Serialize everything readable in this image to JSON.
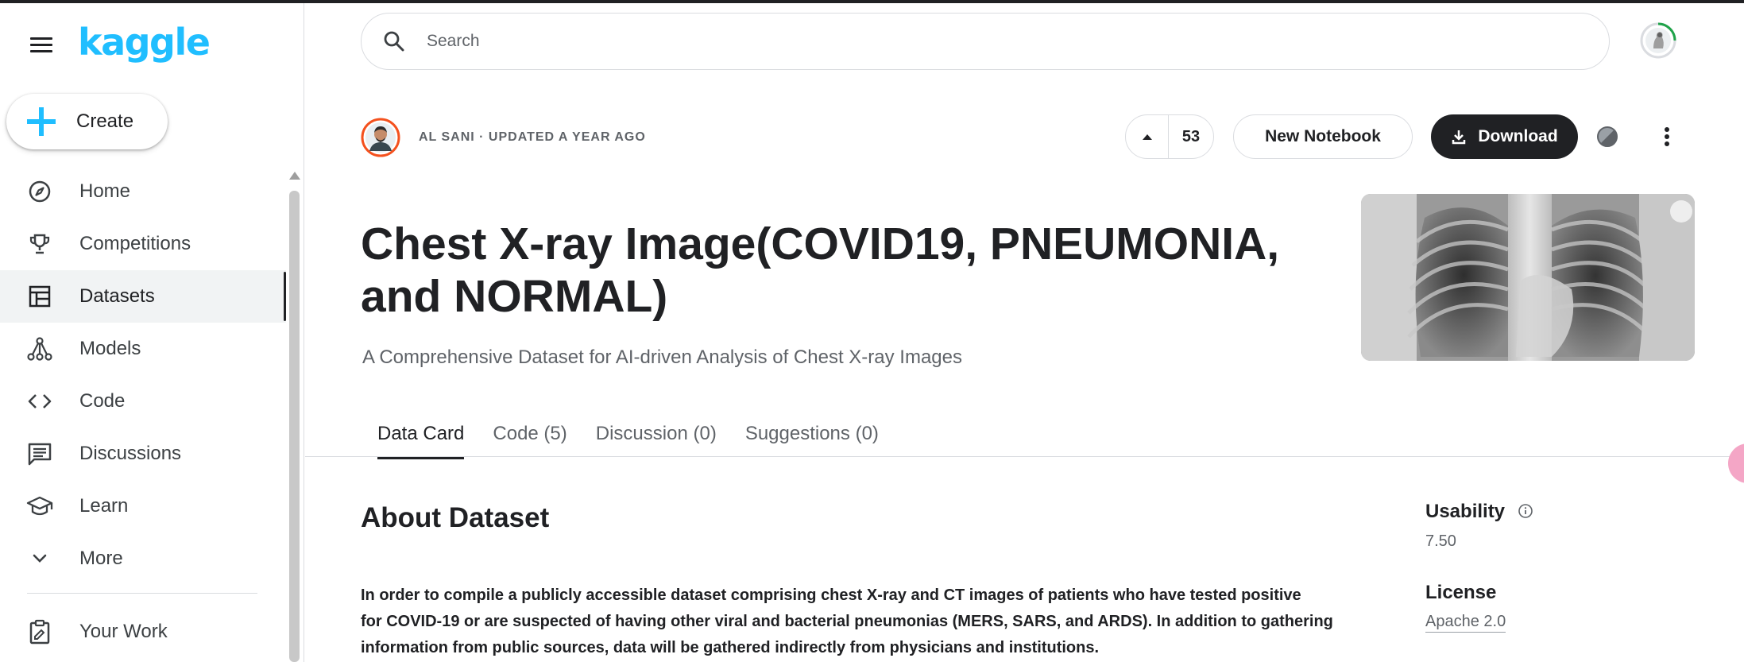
{
  "sidebar": {
    "logo": "kaggle",
    "create_label": "Create",
    "items": [
      {
        "label": "Home",
        "icon": "compass-icon",
        "active": false
      },
      {
        "label": "Competitions",
        "icon": "trophy-icon",
        "active": false
      },
      {
        "label": "Datasets",
        "icon": "table-icon",
        "active": true
      },
      {
        "label": "Models",
        "icon": "models-icon",
        "active": false
      },
      {
        "label": "Code",
        "icon": "code-icon",
        "active": false
      },
      {
        "label": "Discussions",
        "icon": "comment-icon",
        "active": false
      },
      {
        "label": "Learn",
        "icon": "school-icon",
        "active": false
      },
      {
        "label": "More",
        "icon": "chevron-down-icon",
        "active": false
      }
    ],
    "your_work_label": "Your Work"
  },
  "search": {
    "placeholder": "Search"
  },
  "dataset": {
    "author_line": "AL SANI · UPDATED A YEAR AGO",
    "vote_count": "53",
    "new_notebook_label": "New Notebook",
    "download_label": "Download",
    "title": "Chest X-ray Image(COVID19, PNEUMONIA, and NORMAL)",
    "subtitle": "A Comprehensive Dataset for AI-driven Analysis of Chest X-ray Images"
  },
  "tabs": [
    {
      "label": "Data Card",
      "active": true
    },
    {
      "label": "Code (5)",
      "active": false
    },
    {
      "label": "Discussion (0)",
      "active": false
    },
    {
      "label": "Suggestions (0)",
      "active": false
    }
  ],
  "about": {
    "heading": "About Dataset",
    "text_lines": [
      "In order to compile a publicly accessible dataset comprising chest X-ray and CT images of patients who have tested positive",
      "for COVID-19 or are suspected of having other viral and bacterial pneumonias (MERS, SARS, and ARDS). In addition to gathering",
      "information from public sources, data will be gathered indirectly from physicians and institutions."
    ]
  },
  "meta": {
    "usability_label": "Usability",
    "usability_value": "7.50",
    "license_label": "License",
    "license_value": "Apache 2.0"
  },
  "colors": {
    "brand": "#20beff",
    "dark": "#202124",
    "muted": "#5f6368",
    "border": "#dadce0"
  }
}
